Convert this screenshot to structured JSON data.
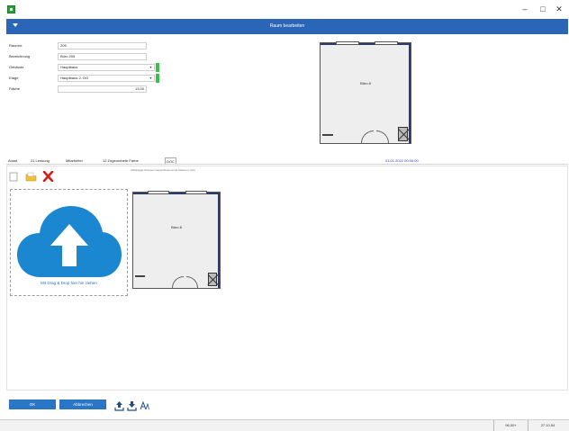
{
  "window": {
    "minimize_icon": "minimize-icon",
    "maximize_icon": "maximize-icon",
    "close_icon": "close-icon",
    "minimize_glyph": "–",
    "maximize_glyph": "□",
    "close_glyph": "✕"
  },
  "dialog": {
    "title": "Raum bearbeiten",
    "accent_color": "#2b65b8"
  },
  "form": {
    "fields": [
      {
        "label": "Raumnr.",
        "value": "205"
      },
      {
        "label": "Bezeichnung",
        "value": "Büro 205"
      },
      {
        "label": "Gebäude",
        "value": "Hauptbaus"
      },
      {
        "label": "Etage",
        "value": "Hauptbaus 2. OG"
      },
      {
        "label": "Fläche",
        "value": "13,00"
      }
    ]
  },
  "plans": {
    "room_label": "Büro 8",
    "small_label": "Büro 8"
  },
  "tabs": [
    {
      "label": "Ausst."
    },
    {
      "label": "21 Lenkung"
    },
    {
      "label": "Mitarbeiter"
    },
    {
      "label": "12 Zugeordnete Farbe"
    },
    {
      "label": "DOC"
    }
  ],
  "timestamp": "01.01.2022 00:00:00",
  "documents": {
    "hint": "Abhängige Gruppenmappe/Dokumente-Dateien (.doc)",
    "drop_text": "Mit Drag & Drop hier hin ziehen"
  },
  "buttons": {
    "ok": "OK",
    "cancel": "Abbrechen"
  },
  "status": {
    "cell1": "",
    "cell2": "96,00+",
    "cell3": "27.10.54"
  }
}
